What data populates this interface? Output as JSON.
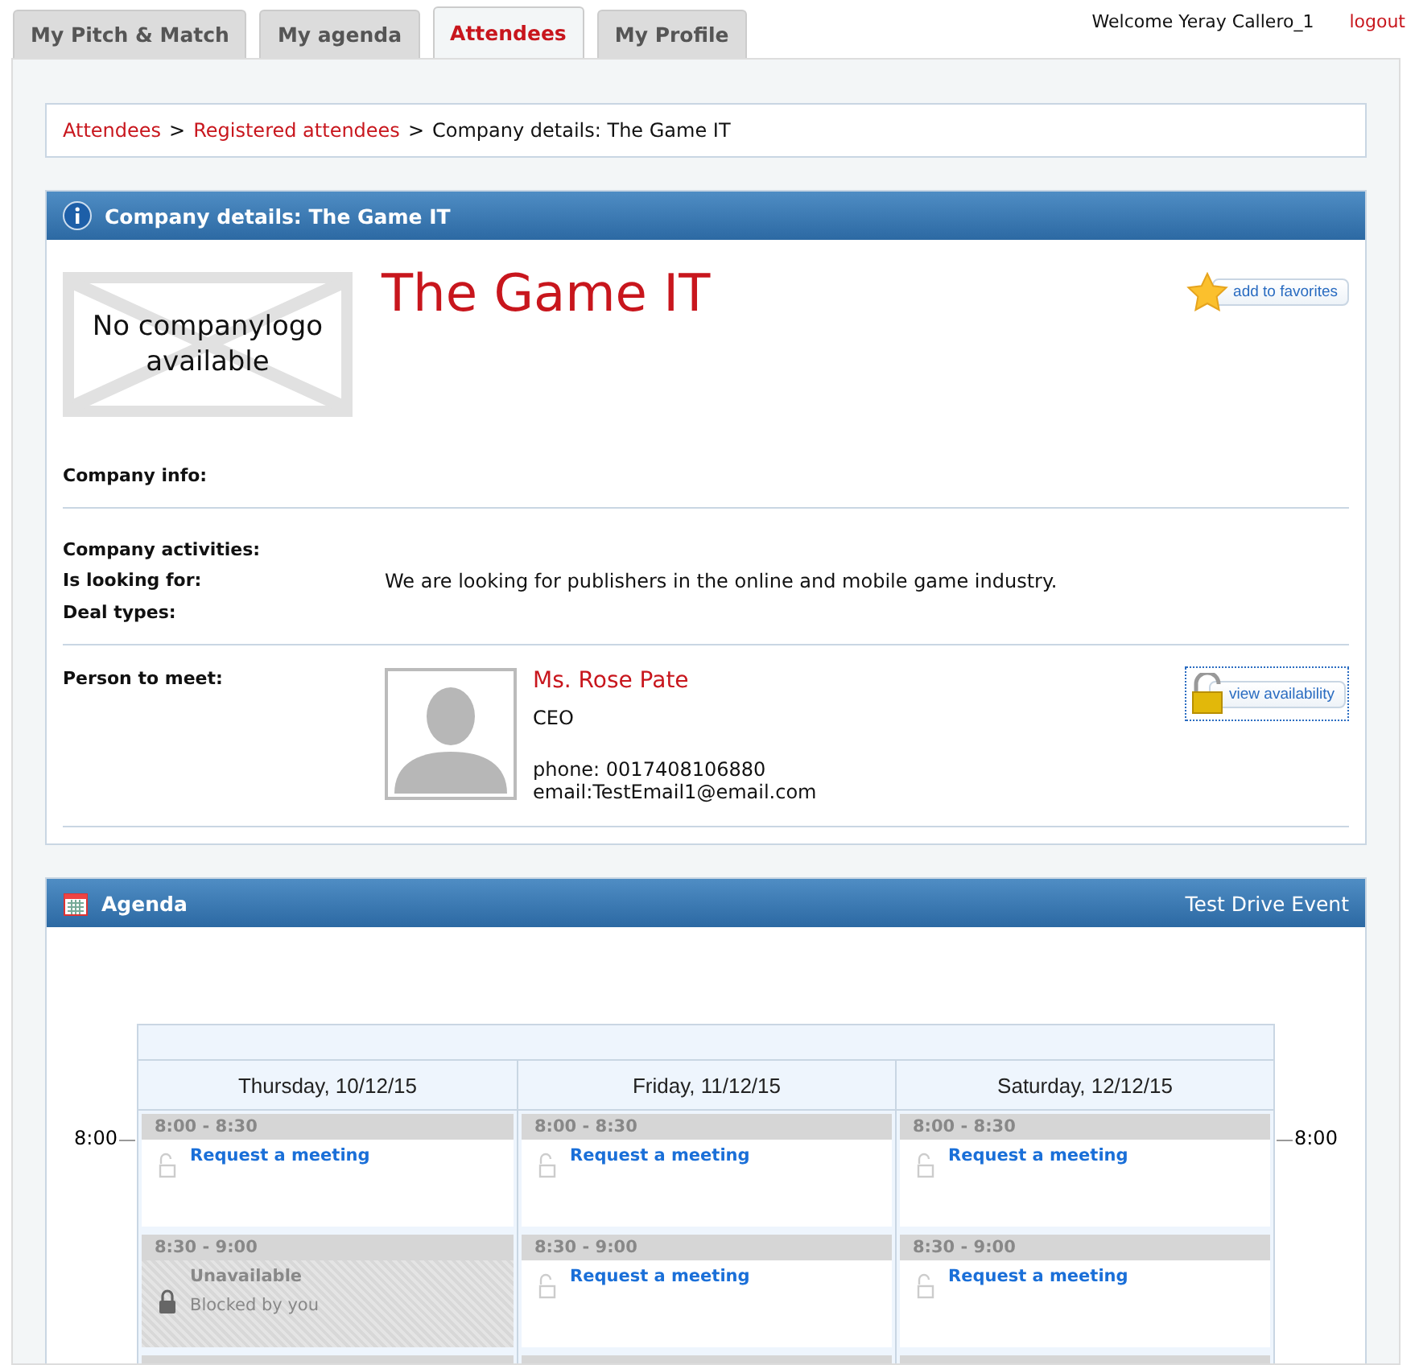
{
  "tabs": [
    {
      "label": "My Pitch & Match",
      "selected": false
    },
    {
      "label": "My agenda",
      "selected": false
    },
    {
      "label": "Attendees",
      "selected": true
    },
    {
      "label": "My Profile",
      "selected": false
    }
  ],
  "user": {
    "welcome": "Welcome Yeray Callero_1",
    "logout": "logout"
  },
  "breadcrumb": {
    "links": [
      "Attendees",
      "Registered attendees"
    ],
    "separator": ">",
    "current": "Company details: The Game IT"
  },
  "company": {
    "panel_title": "Company details: The Game IT",
    "logo_text": "No companylogo available",
    "name": "The Game IT",
    "favorite_button": "add to favorites",
    "fields": [
      {
        "label": "Company info:"
      },
      {
        "label": "Company activities:"
      },
      {
        "label": "Is looking for:",
        "value": "We are looking for publishers in the online and mobile game industry."
      },
      {
        "label": "Deal types:"
      }
    ],
    "person_label": "Person to meet:",
    "person": {
      "name": "Ms. Rose Pate",
      "title": "CEO",
      "phone": "phone: 0017408106880",
      "email": "email:TestEmail1@email.com"
    },
    "availability_button": "view availability"
  },
  "agenda": {
    "title": "Agenda",
    "event": "Test Drive Event",
    "hour_labels": [
      "8:00",
      "8:00"
    ],
    "days": [
      {
        "label": "Thursday, 10/12/15",
        "slots": [
          {
            "time": "8:00 - 8:30",
            "kind": "available",
            "text": "Request a meeting"
          },
          {
            "time": "8:30 - 9:00",
            "kind": "unavailable",
            "text": "Unavailable",
            "note": "Blocked by you"
          }
        ]
      },
      {
        "label": "Friday, 11/12/15",
        "slots": [
          {
            "time": "8:00 - 8:30",
            "kind": "available",
            "text": "Request a meeting"
          },
          {
            "time": "8:30 - 9:00",
            "kind": "available",
            "text": "Request a meeting"
          }
        ]
      },
      {
        "label": "Saturday, 12/12/15",
        "slots": [
          {
            "time": "8:00 - 8:30",
            "kind": "available",
            "text": "Request a meeting"
          },
          {
            "time": "8:30 - 9:00",
            "kind": "available",
            "text": "Request a meeting"
          }
        ]
      }
    ]
  }
}
